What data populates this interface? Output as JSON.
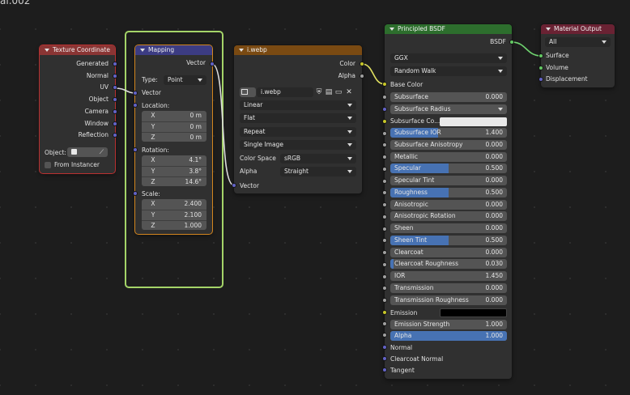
{
  "fragment_title": "al.002",
  "colors": {
    "input_header": "#8a3534",
    "vector_header": "#3c3c83",
    "texture_header": "#7a4a12",
    "shader_header": "#2d6e2d",
    "output_header": "#6a2233",
    "frame": "#a4d468",
    "selected_outline": "#d2851e",
    "field_fill": "#4772b3",
    "socket_vector": "#6363c7",
    "socket_color": "#c7c729",
    "socket_float": "#a1a1a1",
    "socket_shader": "#63c763"
  },
  "texcoord": {
    "title": "Texture Coordinate",
    "outputs": [
      "Generated",
      "Normal",
      "UV",
      "Object",
      "Camera",
      "Window",
      "Reflection"
    ],
    "object_label": "Object:",
    "from_instancer": "From Instancer",
    "eyedropper_icon": "eyedropper-icon"
  },
  "mapping": {
    "title": "Mapping",
    "out_vector": "Vector",
    "type_label": "Type:",
    "type_value": "Point",
    "in_vector": "Vector",
    "location_label": "Location:",
    "location": [
      {
        "k": "X",
        "v": "0 m"
      },
      {
        "k": "Y",
        "v": "0 m"
      },
      {
        "k": "Z",
        "v": "0 m"
      }
    ],
    "rotation_label": "Rotation:",
    "rotation": [
      {
        "k": "X",
        "v": "4.1°"
      },
      {
        "k": "Y",
        "v": "3.8°"
      },
      {
        "k": "Z",
        "v": "14.6°"
      }
    ],
    "scale_label": "Scale:",
    "scale": [
      {
        "k": "X",
        "v": "2.400"
      },
      {
        "k": "Y",
        "v": "2.100"
      },
      {
        "k": "Z",
        "v": "1.000"
      }
    ]
  },
  "image": {
    "title": "i.webp",
    "out_color": "Color",
    "out_alpha": "Alpha",
    "image_name": "i.webp",
    "interpolation": "Linear",
    "projection": "Flat",
    "extension": "Repeat",
    "source": "Single Image",
    "color_space_label": "Color Space",
    "color_space": "sRGB",
    "alpha_label": "Alpha",
    "alpha_mode": "Straight",
    "in_vector": "Vector"
  },
  "bsdf": {
    "title": "Principled BSDF",
    "out_bsdf": "BSDF",
    "distribution": "GGX",
    "subsurface_method": "Random Walk",
    "base_color": "Base Color",
    "subsurface": {
      "label": "Subsurface",
      "value": "0.000",
      "fraction": 0
    },
    "subsurface_radius": "Subsurface Radius",
    "subsurface_color": "Subsurface Co...",
    "subsurface_color_swatch": "#e8e8e8",
    "sliders": [
      {
        "label": "Subsurface IOR",
        "value": "1.400",
        "fraction": 0.41
      },
      {
        "label": "Subsurface Anisotropy",
        "value": "0.000",
        "fraction": 0
      },
      {
        "label": "Metallic",
        "value": "0.000",
        "fraction": 0
      },
      {
        "label": "Specular",
        "value": "0.500",
        "fraction": 0.5
      },
      {
        "label": "Specular Tint",
        "value": "0.000",
        "fraction": 0
      },
      {
        "label": "Roughness",
        "value": "0.500",
        "fraction": 0.5
      },
      {
        "label": "Anisotropic",
        "value": "0.000",
        "fraction": 0
      },
      {
        "label": "Anisotropic Rotation",
        "value": "0.000",
        "fraction": 0
      },
      {
        "label": "Sheen",
        "value": "0.000",
        "fraction": 0
      },
      {
        "label": "Sheen Tint",
        "value": "0.500",
        "fraction": 0.5
      },
      {
        "label": "Clearcoat",
        "value": "0.000",
        "fraction": 0
      },
      {
        "label": "Clearcoat Roughness",
        "value": "0.030",
        "fraction": 0.03
      },
      {
        "label": "IOR",
        "value": "1.450",
        "fraction": 0
      },
      {
        "label": "Transmission",
        "value": "0.000",
        "fraction": 0
      },
      {
        "label": "Transmission Roughness",
        "value": "0.000",
        "fraction": 0
      }
    ],
    "emission": "Emission",
    "emission_swatch": "#000000",
    "emission_strength": {
      "label": "Emission Strength",
      "value": "1.000",
      "fraction": 0
    },
    "alpha": {
      "label": "Alpha",
      "value": "1.000",
      "fraction": 1
    },
    "normal": "Normal",
    "clearcoat_normal": "Clearcoat Normal",
    "tangent": "Tangent"
  },
  "output": {
    "title": "Material Output",
    "target": "All",
    "inputs": [
      "Surface",
      "Volume",
      "Displacement"
    ]
  }
}
